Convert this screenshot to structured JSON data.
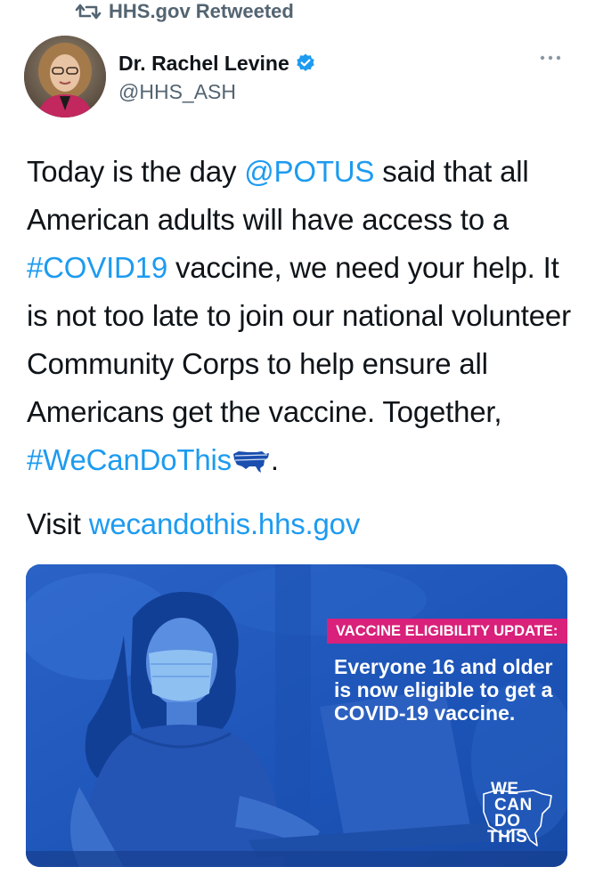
{
  "retweet": {
    "label": "HHS.gov Retweeted",
    "icon": "retweet-icon"
  },
  "author": {
    "display_name": "Dr. Rachel Levine",
    "handle": "@HHS_ASH",
    "verified_icon": "verified-badge-icon",
    "avatar_icon": "avatar"
  },
  "more_icon": "more-options-icon",
  "tweet": {
    "line1_a": "Today is the day ",
    "mention_potus": "@POTUS",
    "line1_b": " said that all American adults will have access to a ",
    "hashtag_covid": "#COVID19",
    "line1_c": " vaccine, we need your help. It is not too late to join our national volunteer Community Corps to help ensure all Americans get the vaccine. Together, ",
    "hashtag_wecandothis": "#WeCanDoThis",
    "emoji": "usa-map-emoji",
    "line1_end": ".",
    "visit_prefix": "Visit ",
    "visit_link": "wecandothis.hhs.gov"
  },
  "media": {
    "badge": "VACCINE ELIGIBILITY UPDATE:",
    "headline": "Everyone 16 and older is now eligible to get a COVID-19 vaccine.",
    "logo": {
      "line1": "WE",
      "line2": "CAN",
      "line3": "DO",
      "line4": "THIS"
    }
  },
  "colors": {
    "link": "#1d9bf0",
    "muted": "#536471",
    "text": "#0f1419",
    "badge": "#d9207a",
    "media_blue": "#1d5bbf"
  }
}
